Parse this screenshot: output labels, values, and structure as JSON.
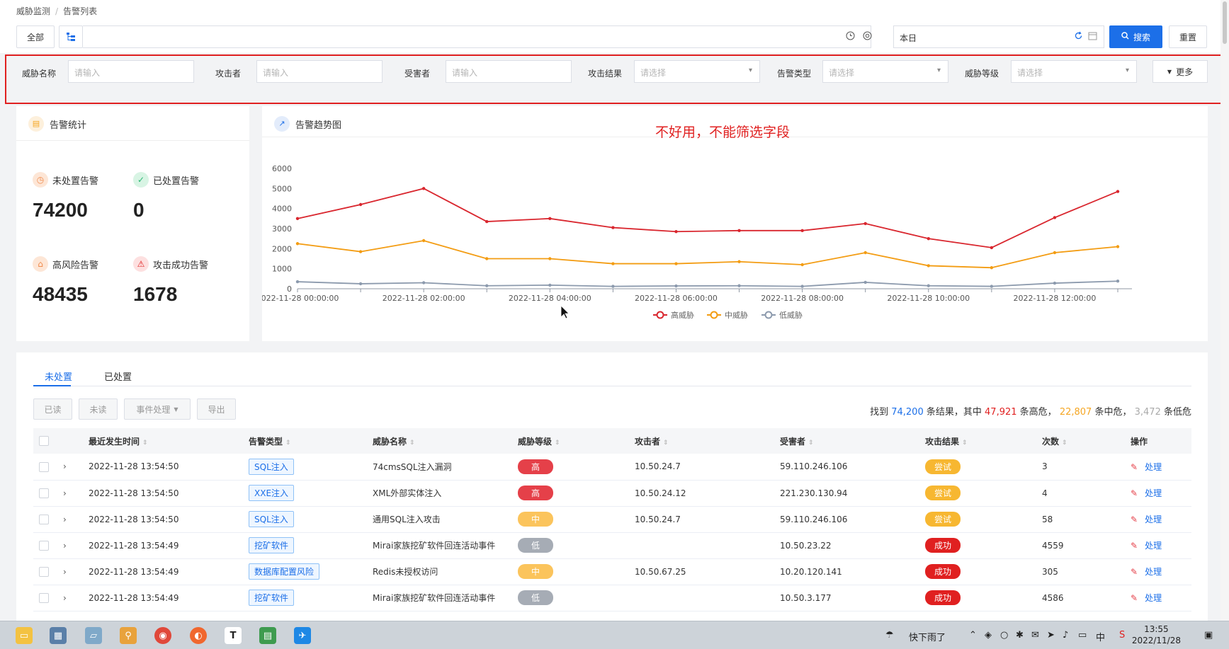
{
  "breadcrumb": {
    "root": "威胁监测",
    "current": "告警列表"
  },
  "toolbar": {
    "all_label": "全部",
    "date_value": "本日",
    "search_label": "搜索",
    "reset_label": "重置"
  },
  "filters": {
    "threat_name_label": "威胁名称",
    "threat_name_placeholder": "请输入",
    "attacker_label": "攻击者",
    "attacker_placeholder": "请输入",
    "victim_label": "受害者",
    "victim_placeholder": "请输入",
    "result_label": "攻击结果",
    "result_placeholder": "请选择",
    "type_label": "告警类型",
    "type_placeholder": "请选择",
    "level_label": "威胁等级",
    "level_placeholder": "请选择",
    "more_label": "更多"
  },
  "stats": {
    "title": "告警统计",
    "unhandled_label": "未处置告警",
    "unhandled_value": "74200",
    "handled_label": "已处置告警",
    "handled_value": "0",
    "high_label": "高风险告警",
    "high_value": "48435",
    "success_label": "攻击成功告警",
    "success_value": "1678"
  },
  "trend": {
    "title": "告警趋势图"
  },
  "annotation": "不好用，不能筛选字段",
  "chart_data": {
    "type": "line",
    "x": [
      "2022-11-28 00:00:00",
      "2022-11-28 01:00:00",
      "2022-11-28 02:00:00",
      "2022-11-28 03:00:00",
      "2022-11-28 04:00:00",
      "2022-11-28 05:00:00",
      "2022-11-28 06:00:00",
      "2022-11-28 07:00:00",
      "2022-11-28 08:00:00",
      "2022-11-28 09:00:00",
      "2022-11-28 10:00:00",
      "2022-11-28 11:00:00",
      "2022-11-28 12:00:00",
      "2022-11-28 13:00:00"
    ],
    "x_tick_labels": [
      "2022-11-28 00:00:00",
      "2022-11-28 02:00:00",
      "2022-11-28 04:00:00",
      "2022-11-28 06:00:00",
      "2022-11-28 08:00:00",
      "2022-11-28 10:00:00",
      "2022-11-28 12:00:00"
    ],
    "y_ticks": [
      0,
      1000,
      2000,
      3000,
      4000,
      5000,
      6000
    ],
    "ylim": [
      0,
      6000
    ],
    "legend_position": "bottom",
    "grid": false,
    "series": [
      {
        "name": "高威胁",
        "color": "#d9262e",
        "values": [
          3500,
          4200,
          5000,
          3350,
          3500,
          3050,
          2850,
          2900,
          2900,
          3250,
          2500,
          2050,
          3550,
          4850
        ]
      },
      {
        "name": "中威胁",
        "color": "#f39c12",
        "values": [
          2250,
          1850,
          2400,
          1500,
          1500,
          1250,
          1250,
          1350,
          1200,
          1800,
          1150,
          1050,
          1800,
          2100
        ]
      },
      {
        "name": "低威胁",
        "color": "#8c9aad",
        "values": [
          350,
          250,
          300,
          150,
          180,
          120,
          140,
          150,
          120,
          320,
          150,
          120,
          280,
          380
        ]
      }
    ]
  },
  "tabs": {
    "unhandled": "未处置",
    "handled": "已处置"
  },
  "actions": {
    "read": "已读",
    "unread": "未读",
    "event": "事件处理",
    "export": "导出"
  },
  "summary": {
    "prefix": "找到",
    "total": "74,200",
    "mid1": "条结果，其中",
    "high": "47,921",
    "mid2": "条高危，",
    "medium": "22,807",
    "mid3": "条中危，",
    "low": "3,472",
    "suffix": "条低危"
  },
  "table": {
    "headers": {
      "time": "最近发生时间",
      "type": "告警类型",
      "name": "威胁名称",
      "level": "威胁等级",
      "attacker": "攻击者",
      "victim": "受害者",
      "result": "攻击结果",
      "count": "次数",
      "op": "操作"
    },
    "rows": [
      {
        "time": "2022-11-28 13:54:50",
        "type": "SQL注入",
        "name": "74cmsSQL注入漏洞",
        "level": "高",
        "level_class": "high",
        "attacker": "10.50.24.7",
        "victim": "59.110.246.106",
        "result": "尝试",
        "result_class": "try",
        "count": "3",
        "op": "处理"
      },
      {
        "time": "2022-11-28 13:54:50",
        "type": "XXE注入",
        "name": "XML外部实体注入",
        "level": "高",
        "level_class": "high",
        "attacker": "10.50.24.12",
        "victim": "221.230.130.94",
        "result": "尝试",
        "result_class": "try",
        "count": "4",
        "op": "处理"
      },
      {
        "time": "2022-11-28 13:54:50",
        "type": "SQL注入",
        "name": "通用SQL注入攻击",
        "level": "中",
        "level_class": "mid",
        "attacker": "10.50.24.7",
        "victim": "59.110.246.106",
        "result": "尝试",
        "result_class": "try",
        "count": "58",
        "op": "处理"
      },
      {
        "time": "2022-11-28 13:54:49",
        "type": "挖矿软件",
        "name": "Mirai家族挖矿软件回连活动事件",
        "level": "低",
        "level_class": "low",
        "attacker": "",
        "victim": "10.50.23.22",
        "result": "成功",
        "result_class": "succ",
        "count": "4559",
        "op": "处理"
      },
      {
        "time": "2022-11-28 13:54:49",
        "type": "数据库配置风险",
        "name": "Redis未授权访问",
        "level": "中",
        "level_class": "mid",
        "attacker": "10.50.67.25",
        "victim": "10.20.120.141",
        "result": "成功",
        "result_class": "succ",
        "count": "305",
        "op": "处理"
      },
      {
        "time": "2022-11-28 13:54:49",
        "type": "挖矿软件",
        "name": "Mirai家族挖矿软件回连活动事件",
        "level": "低",
        "level_class": "low",
        "attacker": "",
        "victim": "10.50.3.177",
        "result": "成功",
        "result_class": "succ",
        "count": "4586",
        "op": "处理"
      }
    ]
  },
  "taskbar": {
    "weather": "快下雨了",
    "ime": "中",
    "time": "13:55",
    "date": "2022/11/28"
  }
}
